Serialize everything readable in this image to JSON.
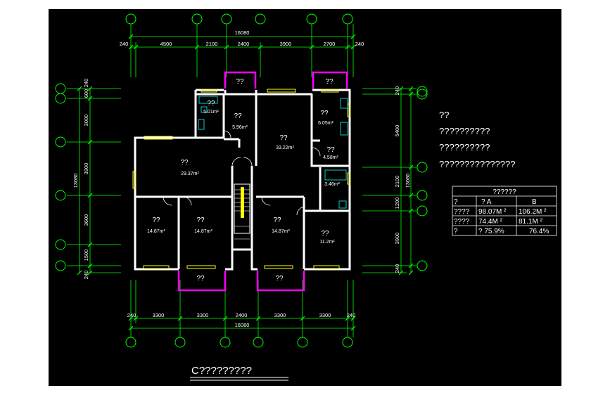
{
  "colors": {
    "outer": "#ffffff",
    "canvas": "#000000",
    "wall": "#ffffff",
    "dim": "#00ff00",
    "balcony": "#ff00ff",
    "window": "#ffff00",
    "fixture": "#00ffff",
    "text": "#ffffff"
  },
  "drawing": {
    "top_total": "16080",
    "top_segments": [
      "240",
      "4500",
      "2100",
      "2400",
      "3900",
      "2700",
      "240"
    ],
    "bottom_total": "16080",
    "bottom_segments": [
      "240",
      "3300",
      "3300",
      "2400",
      "3300",
      "3300",
      "240"
    ],
    "left_total": "13080",
    "left_segments": [
      "240",
      "600",
      "3000",
      "3900",
      "3600",
      "1500",
      "240"
    ],
    "right_total": "13080",
    "right_segments": [
      "240",
      "5400",
      "2100",
      "1200",
      "3900",
      "240"
    ],
    "balcony_labels": [
      "??",
      "??",
      "??",
      "??"
    ],
    "rooms": [
      {
        "name": "??",
        "area": "5.01m²"
      },
      {
        "name": "??",
        "area": "5.96m²"
      },
      {
        "name": "??",
        "area": "33.22m²"
      },
      {
        "name": "??",
        "area": "6.05m²"
      },
      {
        "name": "??",
        "area": "4.58m²"
      },
      {
        "name": "??",
        "area": "29.37m²"
      },
      {
        "name": "",
        "area": "3.46m²"
      },
      {
        "name": "??",
        "area": "14.87m²"
      },
      {
        "name": "??",
        "area": "14.87m²"
      },
      {
        "name": "??",
        "area": "14.87m²"
      },
      {
        "name": "??",
        "area": "11.2m²"
      }
    ],
    "caption": "C?????????"
  },
  "notes": {
    "heading": "??",
    "lines": [
      "??????????",
      "??????????",
      "???????????????"
    ]
  },
  "area_table": {
    "title": "??????",
    "header": [
      "?",
      "? A",
      "B"
    ],
    "rows": [
      [
        "????",
        "98.07M ²",
        "106.2M ²"
      ],
      [
        "????",
        "74.4M ²",
        "81.1M ²"
      ],
      [
        "?",
        "? 75.9%",
        "76.4%"
      ]
    ]
  }
}
